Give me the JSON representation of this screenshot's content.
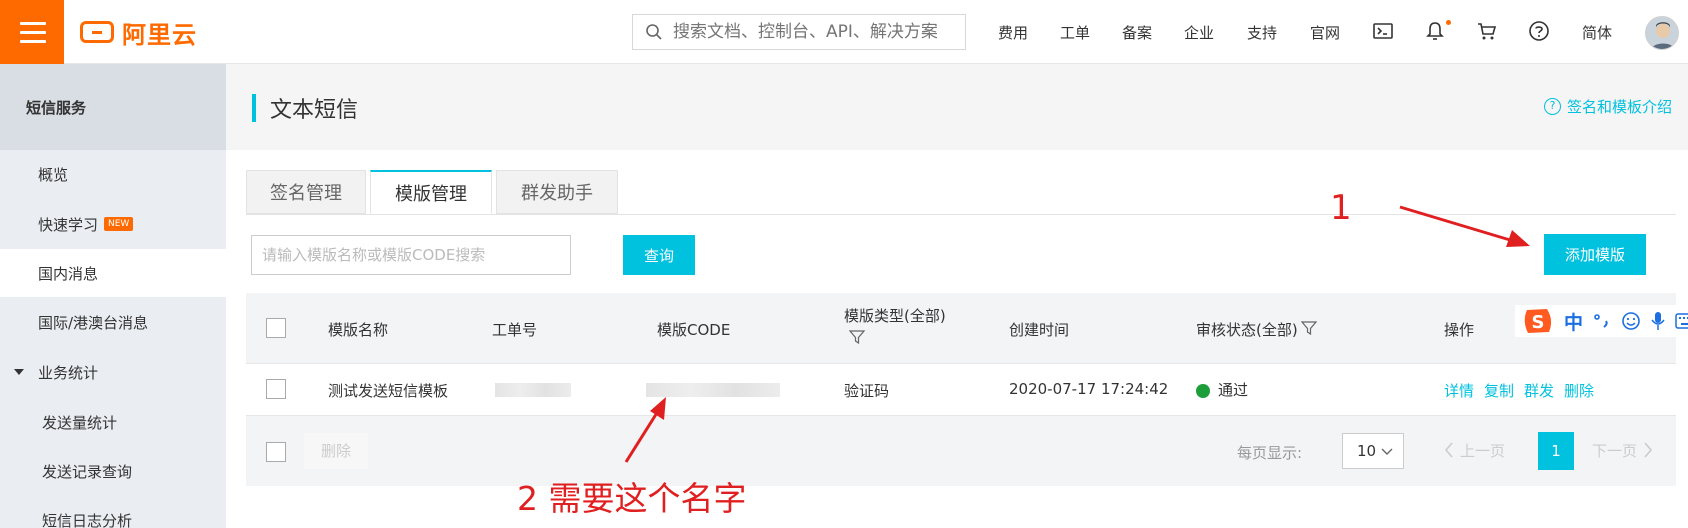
{
  "topbar": {
    "logo_text": "阿里云",
    "search_placeholder": "搜索文档、控制台、API、解决方案",
    "nav": [
      "费用",
      "工单",
      "备案",
      "企业",
      "支持",
      "官网"
    ],
    "lang": "简体"
  },
  "sidebar": {
    "title": "短信服务",
    "items": [
      {
        "label": "概览"
      },
      {
        "label": "快速学习",
        "badge": "NEW"
      },
      {
        "label": "国内消息"
      },
      {
        "label": "国际/港澳台消息"
      },
      {
        "label": "业务统计"
      },
      {
        "label": "发送量统计"
      },
      {
        "label": "发送记录查询"
      },
      {
        "label": "短信日志分析"
      }
    ]
  },
  "page": {
    "title": "文本短信",
    "help_link": "签名和模板介绍",
    "tabs": [
      "签名管理",
      "模版管理",
      "群发助手"
    ],
    "search_placeholder": "请输入模版名称或模版CODE搜索",
    "query_button": "查询",
    "add_button": "添加模版"
  },
  "table": {
    "columns": [
      "模版名称",
      "工单号",
      "模版CODE",
      "模版类型(全部)",
      "创建时间",
      "审核状态(全部)",
      "操作"
    ],
    "rows": [
      {
        "name": "测试发送短信模板",
        "type": "验证码",
        "created": "2020-07-17 17:24:42",
        "status": "通过",
        "actions": [
          "详情",
          "复制",
          "群发",
          "删除"
        ]
      }
    ],
    "footer": {
      "delete_label": "删除",
      "page_size_label": "每页显示:",
      "page_size": "10",
      "prev": "上一页",
      "current_page": "1",
      "next": "下一页"
    }
  },
  "ime": {
    "mode": "中"
  },
  "annotations": {
    "label_1": "1",
    "label_2": "2 需要这个名字"
  },
  "colors": {
    "brand": "#ff6a00",
    "accent": "#00c1de",
    "success": "#1e9e3a",
    "annotation": "#e02020"
  }
}
